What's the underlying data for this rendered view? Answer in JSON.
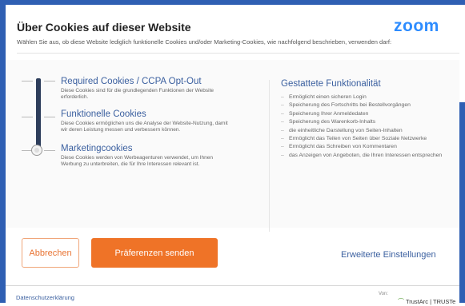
{
  "dialog": {
    "title": "Über Cookies auf dieser Website",
    "subtitle": "Wählen Sie aus, ob diese Website lediglich funktionelle Cookies und/oder Marketing-Cookies, wie nachfolgend beschrieben, verwenden darf:",
    "logo_text": "zoom"
  },
  "levels": [
    {
      "title": "Required Cookies / CCPA Opt-Out",
      "description": "Diese Cookies sind für die grundlegenden Funktionen der Website erforderlich."
    },
    {
      "title": "Funktionelle Cookies",
      "description": "Diese Cookies ermöglichen uns die Analyse der Website-Nutzung, damit wir deren Leistung messen und verbessern können."
    },
    {
      "title": "Marketingcookies",
      "description": "Diese Cookies werden von Werbeagenturen verwendet, um Ihnen Werbung zu unterbreiten, die für Ihre Interessen relevant ist."
    }
  ],
  "slider": {
    "selected_level": 3,
    "levels_count": 3
  },
  "features": {
    "title": "Gestattete Funktionalität",
    "items": [
      "Ermöglicht einen sicheren Login",
      "Speicherung des Fortschritts bei Bestellvorgängen",
      "Speicherung Ihrer Anmeldedaten",
      "Speicherung des Warenkorb-Inhalts",
      "die einheitliche Darstellung von Seiten-Inhalten",
      "Ermöglicht das Teilen von Seiten über Soziale Netzwerke",
      "Ermöglicht das Schreiben von Kommentaren",
      "das Anzeigen von Angeboten, die Ihren Interessen entsprechen"
    ]
  },
  "buttons": {
    "cancel": "Abbrechen",
    "send": "Präferenzen senden",
    "advanced": "Erweiterte Einstellungen"
  },
  "footer": {
    "privacy_link": "Datenschutzerklärung",
    "by_label": "Von:",
    "powered_by": "TrustArc",
    "truste_text": "TRUSTe"
  },
  "colors": {
    "accent": "#ef7327",
    "link": "#3a5f9f",
    "brand": "#2d8cff",
    "frame": "#2f5fb3"
  }
}
